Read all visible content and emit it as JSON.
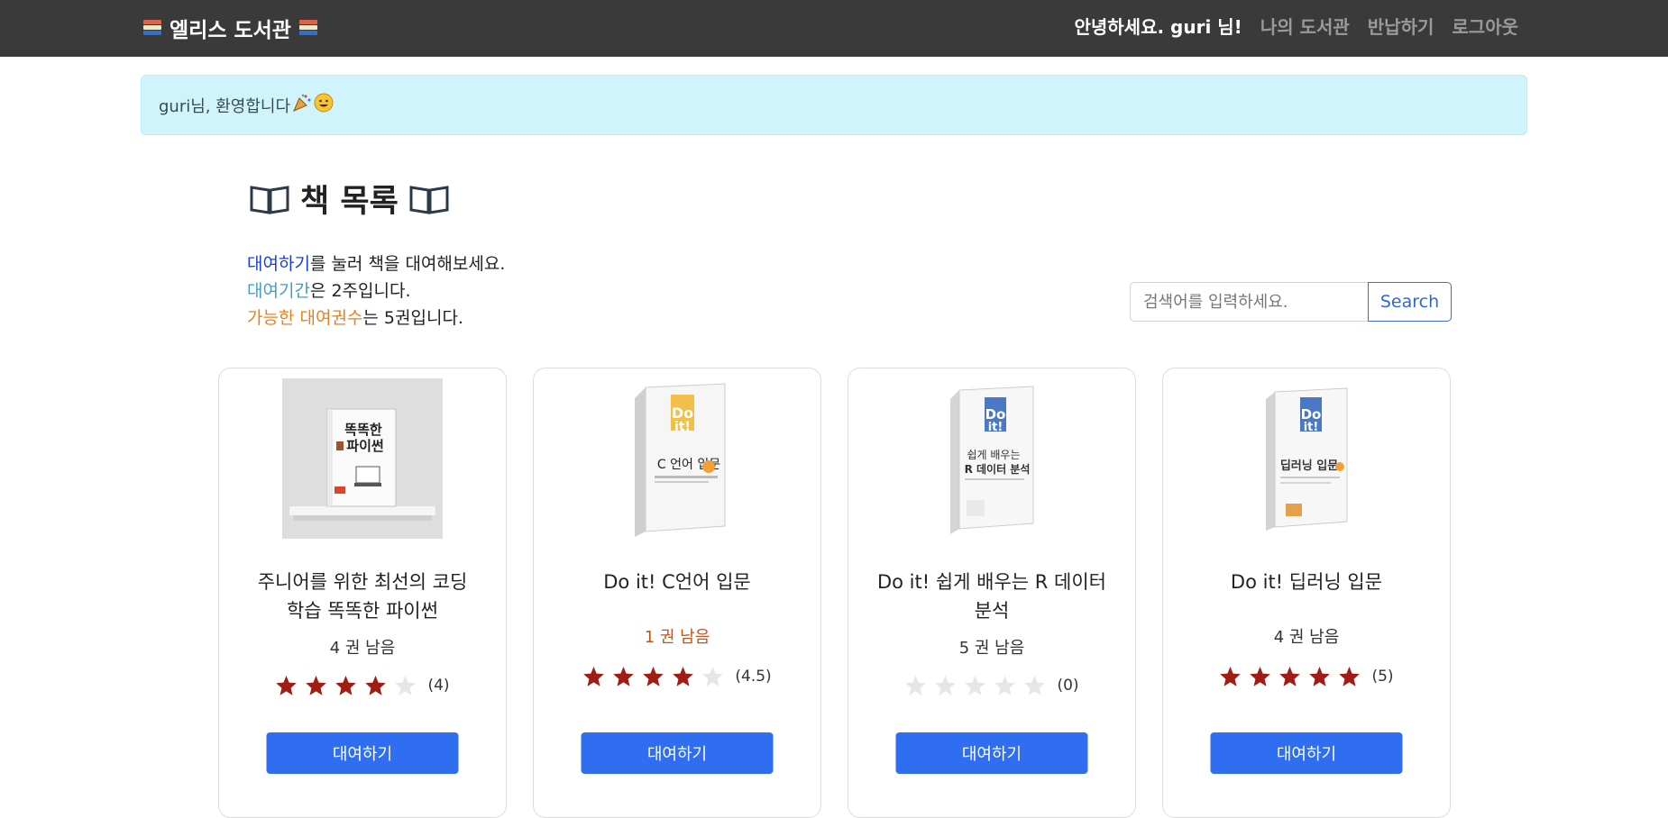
{
  "navbar": {
    "brand": "엘리스 도서관",
    "greeting": "안녕하세요. guri 님!",
    "links": [
      "나의 도서관",
      "반납하기",
      "로그아웃"
    ]
  },
  "alert": {
    "message": "guri님, 환영합니다"
  },
  "heading": {
    "title": "책 목록"
  },
  "info": {
    "line1_highlight": "대여하기",
    "line1_rest": "를 눌러 책을 대여해보세요.",
    "line2_highlight": "대여기간",
    "line2_rest": "은 2주입니다.",
    "line3_highlight": "가능한 대여권수",
    "line3_rest": "는 5권입니다."
  },
  "search": {
    "placeholder": "검색어를 입력하세요.",
    "button_label": "Search"
  },
  "books": [
    {
      "title": "주니어를 위한 최선의 코딩 학습 똑똑한 파이썬",
      "remaining": "4 권 남음",
      "rating": 4,
      "rating_label": "(4)",
      "button": "대여하기",
      "cover_text": "똑똑한 파이썬"
    },
    {
      "title": "Do it! C언어 입문",
      "remaining": "1 권 남음",
      "rating": 4.5,
      "rating_label": "(4.5)",
      "button": "대여하기",
      "cover_text": "C 언어 입문"
    },
    {
      "title": "Do it! 쉽게 배우는 R 데이터 분석",
      "remaining": "5 권 남음",
      "rating": 0,
      "rating_label": "(0)",
      "button": "대여하기",
      "cover_text": "쉽게 배우는 R 데이터 분석"
    },
    {
      "title": "Do it! 딥러닝 입문",
      "remaining": "4 권 남음",
      "rating": 5,
      "rating_label": "(5)",
      "button": "대여하기",
      "cover_text": "딥러닝 입문"
    }
  ],
  "colors": {
    "navbar": "#3a3a3a",
    "alert_bg": "#cff4fc",
    "accent": "#2f6ef0",
    "star_filled": "#a11d14",
    "star_empty": "#e6e6e6"
  }
}
